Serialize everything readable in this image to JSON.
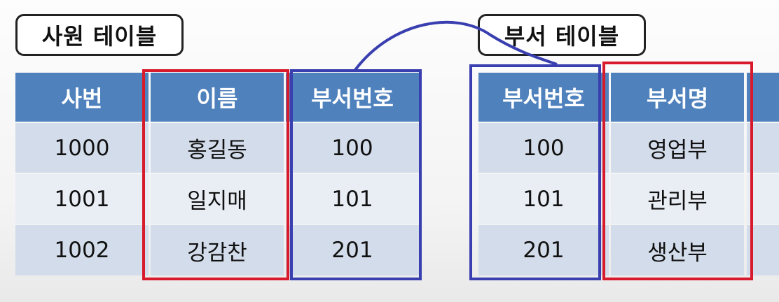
{
  "employee_table": {
    "title": "사원 테이블",
    "headers": [
      "사번",
      "이름",
      "부서번호"
    ],
    "rows": [
      [
        "1000",
        "홍길동",
        "100"
      ],
      [
        "1001",
        "일지매",
        "101"
      ],
      [
        "1002",
        "강감찬",
        "201"
      ]
    ]
  },
  "department_table": {
    "title": "부서 테이블",
    "headers": [
      "부서번호",
      "부서명"
    ],
    "rows": [
      [
        "100",
        "영업부"
      ],
      [
        "101",
        "관리부"
      ],
      [
        "201",
        "생산부"
      ]
    ]
  },
  "colors": {
    "header_bg": "#4f81bd",
    "row_dark": "#d3dcea",
    "row_light": "#e9edf4",
    "highlight_red": "#d71b2c",
    "highlight_blue": "#3a3fb0"
  }
}
